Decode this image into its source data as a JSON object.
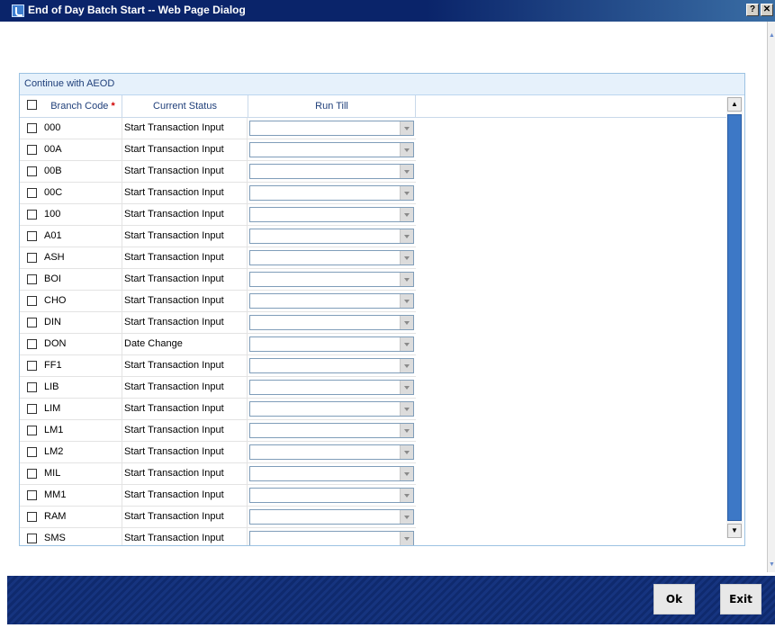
{
  "window": {
    "title": "End of Day Batch Start -- Web Page Dialog",
    "help_label": "?",
    "close_label": "✕"
  },
  "panel": {
    "header": "Continue with AEOD"
  },
  "table": {
    "columns": {
      "code": "Branch Code",
      "required_mark": "*",
      "status": "Current Status",
      "run_till": "Run Till"
    },
    "rows": [
      {
        "code": "000",
        "status": "Start Transaction Input"
      },
      {
        "code": "00A",
        "status": "Start Transaction Input"
      },
      {
        "code": "00B",
        "status": "Start Transaction Input"
      },
      {
        "code": "00C",
        "status": "Start Transaction Input"
      },
      {
        "code": "100",
        "status": "Start Transaction Input"
      },
      {
        "code": "A01",
        "status": "Start Transaction Input"
      },
      {
        "code": "ASH",
        "status": "Start Transaction Input"
      },
      {
        "code": "BOI",
        "status": "Start Transaction Input"
      },
      {
        "code": "CHO",
        "status": "Start Transaction Input"
      },
      {
        "code": "DIN",
        "status": "Start Transaction Input"
      },
      {
        "code": "DON",
        "status": "Date Change"
      },
      {
        "code": "FF1",
        "status": "Start Transaction Input"
      },
      {
        "code": "LIB",
        "status": "Start Transaction Input"
      },
      {
        "code": "LIM",
        "status": "Start Transaction Input"
      },
      {
        "code": "LM1",
        "status": "Start Transaction Input"
      },
      {
        "code": "LM2",
        "status": "Start Transaction Input"
      },
      {
        "code": "MIL",
        "status": "Start Transaction Input"
      },
      {
        "code": "MM1",
        "status": "Start Transaction Input"
      },
      {
        "code": "RAM",
        "status": "Start Transaction Input"
      },
      {
        "code": "SMS",
        "status": "Start Transaction Input"
      },
      {
        "code": "",
        "status": ""
      }
    ]
  },
  "buttons": {
    "ok": "Ok",
    "exit": "Exit"
  },
  "colors": {
    "titlebar": "#0a246a",
    "footer": "#0f2a6e",
    "panel_border": "#9cc2e2",
    "scroll_thumb": "#3d78c6"
  }
}
